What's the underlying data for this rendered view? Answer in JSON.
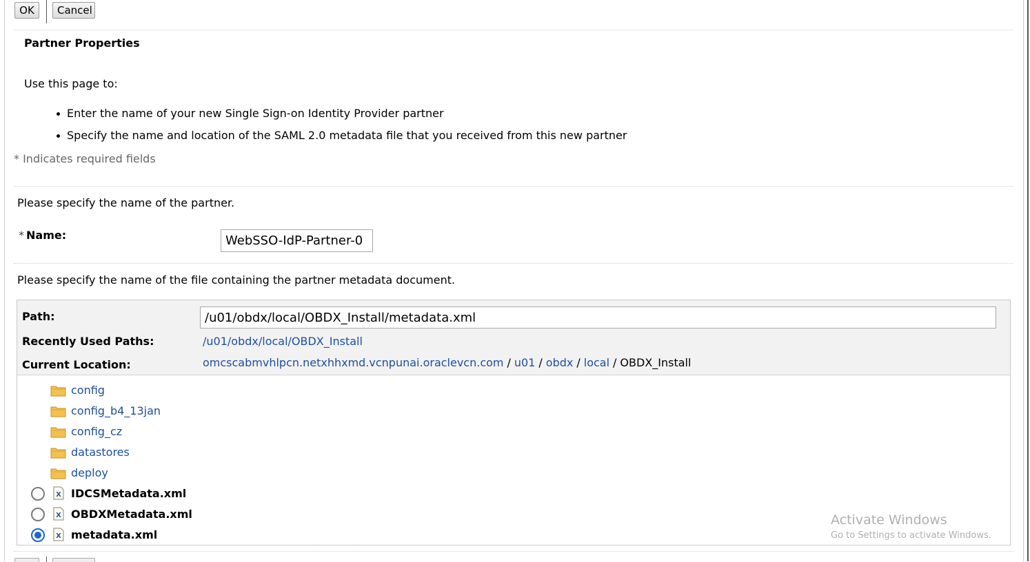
{
  "toolbar": {
    "ok_label": "OK",
    "cancel_label": "Cancel"
  },
  "page": {
    "title": "Partner Properties",
    "intro": "Use this page to:",
    "bullets": [
      "Enter the name of your new Single Sign-on Identity Provider partner",
      "Specify the name and location of the SAML 2.0 metadata file that you received from this new partner"
    ],
    "required_note": "* Indicates required fields"
  },
  "partner": {
    "prompt": "Please specify the name of the partner.",
    "name_star": "*",
    "name_label": "Name:",
    "name_value": "WebSSO-IdP-Partner-0"
  },
  "metadata": {
    "prompt": "Please specify the name of the file containing the partner metadata document.",
    "path_label": "Path:",
    "path_value": "/u01/obdx/local/OBDX_Install/metadata.xml",
    "recent_label": "Recently Used Paths:",
    "recent_path": "/u01/obdx/local/OBDX_Install",
    "location_label": "Current Location:",
    "location": {
      "host": "omcscabmvhlpcn.netxhhxmd.vcnpunai.oraclevcn.com",
      "sep": "/",
      "segments": [
        "u01",
        "obdx",
        "local"
      ],
      "current": "OBDX_Install"
    },
    "folders": [
      "config",
      "config_b4_13jan",
      "config_cz",
      "datastores",
      "deploy"
    ],
    "files": [
      {
        "name": "IDCSMetadata.xml",
        "selected": false
      },
      {
        "name": "OBDXMetadata.xml",
        "selected": false
      },
      {
        "name": "metadata.xml",
        "selected": true
      }
    ]
  },
  "watermark": {
    "title": "Activate Windows",
    "subtitle": "Go to Settings to activate Windows."
  },
  "colors": {
    "link": "#1d4fa3",
    "radio_selected": "#1a66d0",
    "folder": "#f2c14e",
    "panel_head": "#f2f2f2"
  },
  "icons": {
    "folder": "folder-icon",
    "xml_file": "xml-file-icon"
  }
}
